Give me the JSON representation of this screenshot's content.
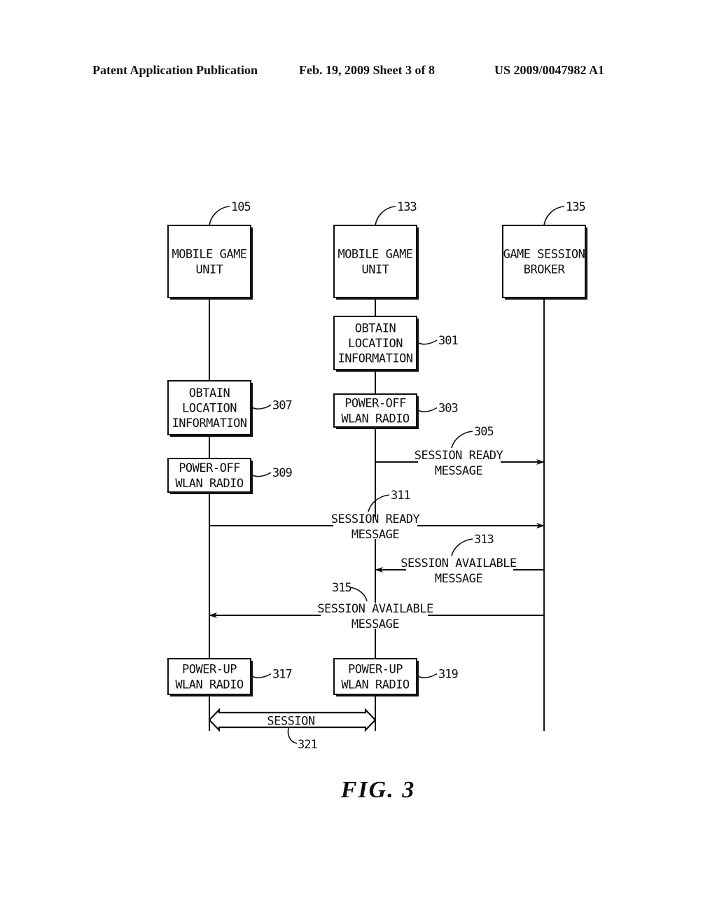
{
  "header": {
    "publication": "Patent Application Publication",
    "date_sheet": "Feb. 19, 2009   Sheet 3 of 8",
    "number": "US 2009/0047982 A1"
  },
  "participants": [
    {
      "ref": "105",
      "lines": [
        "MOBILE GAME",
        "UNIT"
      ]
    },
    {
      "ref": "133",
      "lines": [
        "MOBILE GAME",
        "UNIT"
      ]
    },
    {
      "ref": "135",
      "lines": [
        "GAME SESSION",
        "BROKER"
      ]
    }
  ],
  "steps": [
    {
      "ref": "301",
      "lane": 1,
      "lines": [
        "OBTAIN",
        "LOCATION",
        "INFORMATION"
      ]
    },
    {
      "ref": "303",
      "lane": 1,
      "lines": [
        "POWER-OFF",
        "WLAN RADIO"
      ]
    },
    {
      "ref": "307",
      "lane": 0,
      "lines": [
        "OBTAIN",
        "LOCATION",
        "INFORMATION"
      ]
    },
    {
      "ref": "309",
      "lane": 0,
      "lines": [
        "POWER-OFF",
        "WLAN RADIO"
      ]
    },
    {
      "ref": "317",
      "lane": 0,
      "lines": [
        "POWER-UP",
        "WLAN RADIO"
      ]
    },
    {
      "ref": "319",
      "lane": 1,
      "lines": [
        "POWER-UP",
        "WLAN RADIO"
      ]
    }
  ],
  "messages": [
    {
      "ref": "305",
      "from": 1,
      "to": 2,
      "lines": [
        "SESSION READY",
        "MESSAGE"
      ]
    },
    {
      "ref": "311",
      "from": 0,
      "to": 2,
      "lines": [
        "SESSION READY",
        "MESSAGE"
      ]
    },
    {
      "ref": "313",
      "from": 2,
      "to": 1,
      "lines": [
        "SESSION AVAILABLE",
        "MESSAGE"
      ]
    },
    {
      "ref": "315",
      "from": 2,
      "to": 0,
      "lines": [
        "SESSION AVAILABLE",
        "MESSAGE"
      ]
    }
  ],
  "session": {
    "ref": "321",
    "label": "SESSION",
    "between": [
      0,
      1
    ]
  },
  "figure_label": "FIG. 3"
}
